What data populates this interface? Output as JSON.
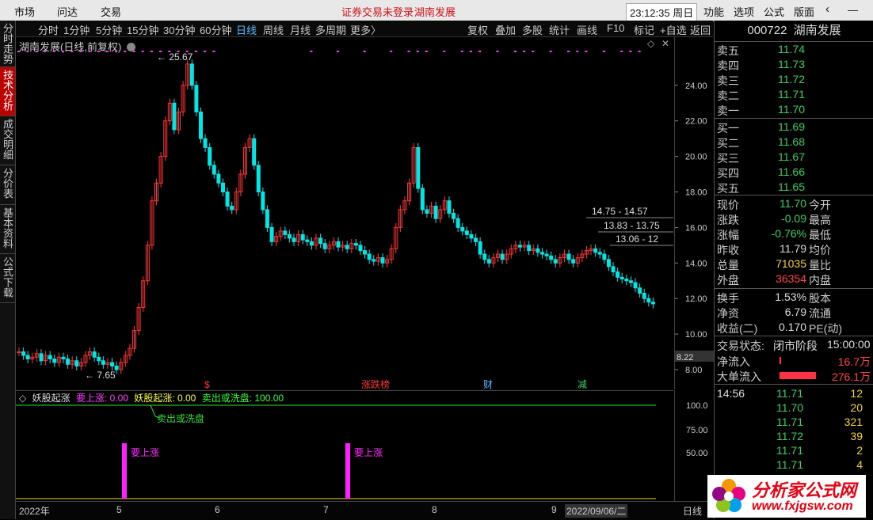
{
  "menu": {
    "items": [
      "市场",
      "问达",
      "交易"
    ],
    "notice_left": "证券交易未登录",
    "notice_right": "湖南发展",
    "clock": "23:12:35 周日",
    "right_items": [
      "功能",
      "选项",
      "公式",
      "版面"
    ]
  },
  "left_tabs": [
    "分时走势",
    "技术分析",
    "成交明细",
    "分价表",
    "基本资料",
    "公式下载"
  ],
  "periods": [
    "分时",
    "1分钟",
    "5分钟",
    "15分钟",
    "30分钟",
    "60分钟",
    "日线",
    "周线",
    "月线",
    "多周期",
    "更多〉"
  ],
  "active_period": "日线",
  "tools": [
    "复权",
    "叠加",
    "多股",
    "统计",
    "画线",
    "F10",
    "标记",
    "+自选",
    "返回"
  ],
  "chart": {
    "title": "湖南发展(日线,前复权)",
    "high_label": "25.67",
    "low_label": "7.65",
    "y_ticks": [
      "24.00",
      "22.00",
      "20.00",
      "18.00",
      "16.00",
      "14.00",
      "12.00",
      "10.00",
      "8.00"
    ],
    "cursor_price": "8.22",
    "range_labels": [
      "14.75 - 14.57",
      "13.83 - 13.75",
      "13.06 - 12"
    ],
    "event_tags": [
      "$",
      "涨跌榜",
      "财",
      "减"
    ],
    "colors": {
      "up": "#ff3333",
      "down": "#00e5e5",
      "marker": "#ff33ff"
    }
  },
  "indicator": {
    "name": "妖股起涨",
    "line1_label": "要上涨: 0.00",
    "line2_label": "妖股起涨: 0.00",
    "line3_label": "卖出或洗盘: 100.00",
    "annotation": "卖出或洗盘",
    "bar_label": "要上涨",
    "y_ticks": [
      "100.0",
      "75.00",
      "50.00"
    ]
  },
  "dates": [
    "2022年",
    "5",
    "6",
    "7",
    "8",
    "9",
    "2022/09/06/二",
    "日线"
  ],
  "quote": {
    "code": "000722",
    "name": "湖南发展",
    "asks": [
      {
        "label": "卖五",
        "price": "11.74"
      },
      {
        "label": "卖四",
        "price": "11.73"
      },
      {
        "label": "卖三",
        "price": "11.72"
      },
      {
        "label": "卖二",
        "price": "11.71"
      },
      {
        "label": "卖一",
        "price": "11.70"
      }
    ],
    "bids": [
      {
        "label": "买一",
        "price": "11.69"
      },
      {
        "label": "买二",
        "price": "11.68"
      },
      {
        "label": "买三",
        "price": "11.67"
      },
      {
        "label": "买四",
        "price": "11.66"
      },
      {
        "label": "买五",
        "price": "11.65"
      }
    ],
    "stats": [
      {
        "l": "现价",
        "v": "11.70",
        "r": "今开",
        "c": "grn"
      },
      {
        "l": "涨跌",
        "v": "-0.09",
        "r": "最高",
        "c": "grn"
      },
      {
        "l": "涨幅",
        "v": "-0.76%",
        "r": "最低",
        "c": "grn"
      },
      {
        "l": "昨收",
        "v": "11.79",
        "r": "均价",
        "c": "wht"
      },
      {
        "l": "总量",
        "v": "71035",
        "r": "量比",
        "c": "yel"
      },
      {
        "l": "外盘",
        "v": "36354",
        "r": "内盘",
        "c": "red"
      }
    ],
    "fund": [
      {
        "l": "换手",
        "v": "1.53%",
        "r": "股本"
      },
      {
        "l": "净资",
        "v": "6.79",
        "r": "流通"
      },
      {
        "l": "收益(二)",
        "v": "0.170",
        "r": "PE(动)"
      }
    ],
    "status_label": "交易状态:",
    "status_value": "闭市阶段",
    "status_time": "15:00:00",
    "net_inflow_label": "净流入",
    "net_inflow_value": "16.7万",
    "big_inflow_label": "大单流入",
    "big_inflow_value": "276.1万",
    "ticks": [
      {
        "t": "14:56",
        "p": "11.71",
        "v": "12"
      },
      {
        "t": "",
        "p": "11.70",
        "v": "20"
      },
      {
        "t": "",
        "p": "11.71",
        "v": "321"
      },
      {
        "t": "",
        "p": "11.72",
        "v": "39"
      },
      {
        "t": "",
        "p": "11.71",
        "v": "2"
      },
      {
        "t": "",
        "p": "11.71",
        "v": "4"
      }
    ]
  },
  "watermark": {
    "title": "分析家公式网",
    "url": "www.fxjgsw.com"
  }
}
